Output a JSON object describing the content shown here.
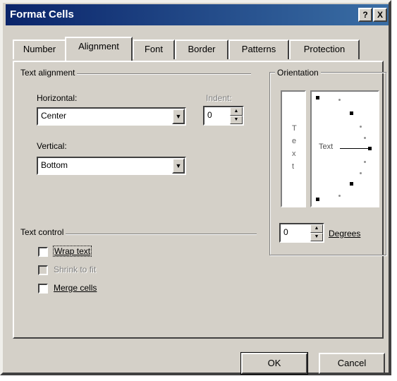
{
  "window": {
    "title": "Format Cells",
    "help_label": "?",
    "close_label": "X"
  },
  "tabs": [
    "Number",
    "Alignment",
    "Font",
    "Border",
    "Patterns",
    "Protection"
  ],
  "text_alignment": {
    "group_label": "Text alignment",
    "horizontal_label": "Horizontal:",
    "horizontal_value": "Center",
    "indent_label": "Indent:",
    "indent_value": "0",
    "vertical_label": "Vertical:",
    "vertical_value": "Bottom"
  },
  "orientation": {
    "group_label": "Orientation",
    "vertical_chars": [
      "T",
      "e",
      "x",
      "t"
    ],
    "text_label": "Text",
    "degrees_value": "0",
    "degrees_label": "Degrees"
  },
  "text_control": {
    "group_label": "Text control",
    "options": [
      {
        "label": "Wrap text",
        "checked": false,
        "enabled": true
      },
      {
        "label": "Shrink to fit",
        "checked": false,
        "enabled": false
      },
      {
        "label": "Merge cells",
        "checked": false,
        "enabled": true
      }
    ]
  },
  "buttons": {
    "ok": "OK",
    "cancel": "Cancel"
  }
}
